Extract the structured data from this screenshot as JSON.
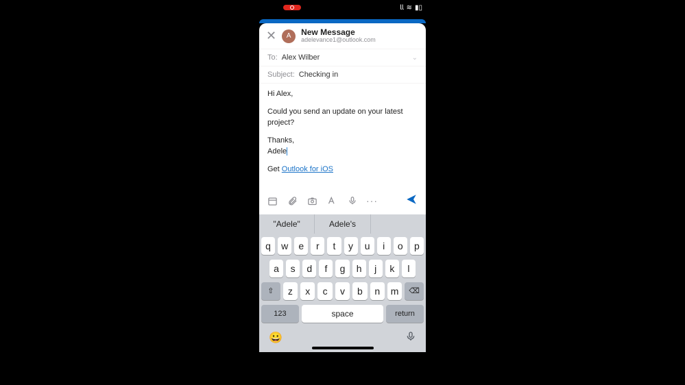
{
  "status": {
    "recording": "●",
    "signal": "𝗅𝗅",
    "wifi": "≋",
    "battery": "▮▯"
  },
  "compose": {
    "title": "New Message",
    "from_email": "adelevance1@outlook.com",
    "avatar_initial": "A",
    "to_label": "To:",
    "to_value": "Alex Wilber",
    "subject_label": "Subject:",
    "subject_value": "Checking in",
    "body": {
      "greeting": "Hi Alex,",
      "line1": "Could you send an update on your latest project?",
      "closing": "Thanks,",
      "signature": "Adele",
      "outlook_prefix": "Get ",
      "outlook_link": "Outlook for iOS"
    }
  },
  "suggestions": [
    "\"Adele\"",
    "Adele's",
    ""
  ],
  "keyboard": {
    "row1": [
      "q",
      "w",
      "e",
      "r",
      "t",
      "y",
      "u",
      "i",
      "o",
      "p"
    ],
    "row2": [
      "a",
      "s",
      "d",
      "f",
      "g",
      "h",
      "j",
      "k",
      "l"
    ],
    "row3": [
      "z",
      "x",
      "c",
      "v",
      "b",
      "n",
      "m"
    ],
    "shift": "⇧",
    "backspace": "⌫",
    "numbers": "123",
    "space": "space",
    "return": "return",
    "emoji": "☺",
    "mic": "🎤"
  }
}
